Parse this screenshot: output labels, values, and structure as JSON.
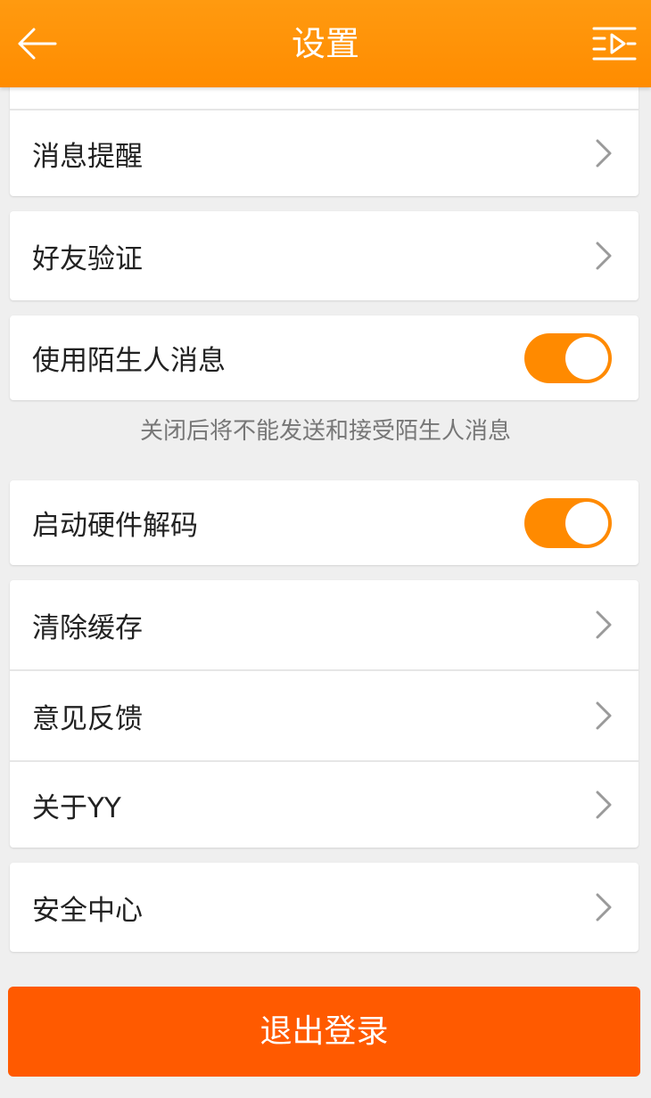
{
  "header": {
    "title": "设置"
  },
  "rows": {
    "message_reminder": "消息提醒",
    "friend_verification": "好友验证",
    "stranger_messages": "使用陌生人消息",
    "hardware_decoding": "启动硬件解码",
    "clear_cache": "清除缓存",
    "feedback": "意见反馈",
    "about": "关于YY",
    "security_center": "安全中心"
  },
  "toggles": {
    "stranger_messages_on": true,
    "hardware_decoding_on": true
  },
  "hint": {
    "stranger_messages": "关闭后将不能发送和接受陌生人消息"
  },
  "logout": {
    "label": "退出登录"
  },
  "colors": {
    "header": "#ff8c00",
    "toggle_on": "#ff8a00",
    "logout": "#ff5a00"
  }
}
